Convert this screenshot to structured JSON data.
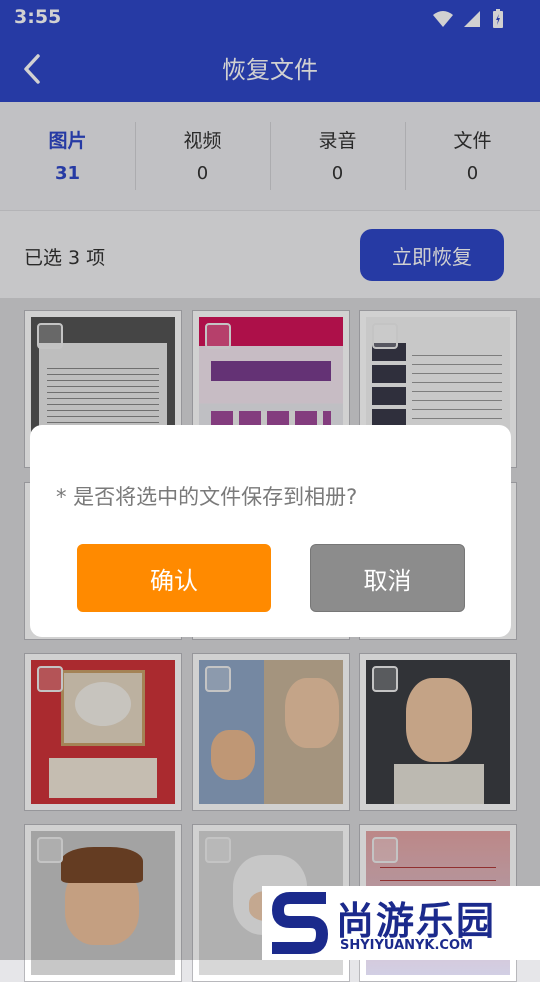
{
  "status_bar": {
    "time": "3:55"
  },
  "app_bar": {
    "title": "恢复文件"
  },
  "tabs": [
    {
      "label": "图片",
      "count": "31"
    },
    {
      "label": "视频",
      "count": "0"
    },
    {
      "label": "录音",
      "count": "0"
    },
    {
      "label": "文件",
      "count": "0"
    }
  ],
  "selection": {
    "text": "已选 3 项",
    "restore_label": "立即恢复"
  },
  "dialog": {
    "message": "* 是否将选中的文件保存到相册?",
    "confirm_label": "确认",
    "cancel_label": "取消"
  },
  "watermark": {
    "brand": "尚游乐园",
    "url": "SHYIYUANYK.COM"
  },
  "thumbnails": [
    "screenshot-document",
    "screenshot-shop",
    "screenshot-list",
    "blank",
    "blank",
    "blank",
    "red-poster-boy",
    "boy-and-girl-portrait",
    "girl-portrait",
    "boy-portrait",
    "white-hair-boy",
    "text-screenshot"
  ],
  "colors": {
    "primary": "#2f47c9",
    "confirm": "#ff8a00",
    "cancel": "#8c8c8c"
  }
}
